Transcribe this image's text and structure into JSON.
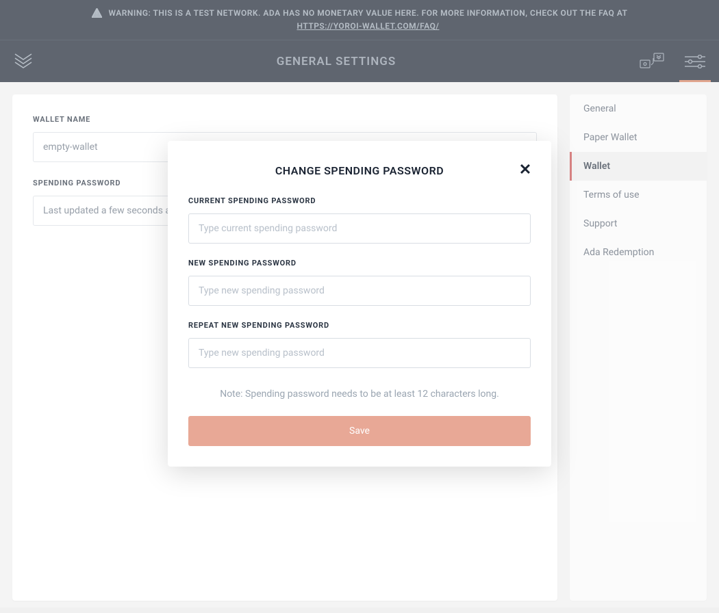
{
  "warning": {
    "text": "WARNING: THIS IS A TEST NETWORK. ADA HAS NO MONETARY VALUE HERE. FOR MORE INFORMATION, CHECK OUT THE FAQ AT",
    "link": "HTTPS://YOROI-WALLET.COM/FAQ/"
  },
  "page_title": "GENERAL SETTINGS",
  "main": {
    "wallet_name_label": "WALLET NAME",
    "wallet_name_value": "empty-wallet",
    "spending_password_label": "SPENDING PASSWORD",
    "spending_password_value": "Last updated a few seconds ago"
  },
  "nav": {
    "items": [
      {
        "label": "General",
        "active": false
      },
      {
        "label": "Paper Wallet",
        "active": false
      },
      {
        "label": "Wallet",
        "active": true
      },
      {
        "label": "Terms of use",
        "active": false
      },
      {
        "label": "Support",
        "active": false
      },
      {
        "label": "Ada Redemption",
        "active": false
      }
    ]
  },
  "modal": {
    "title": "CHANGE SPENDING PASSWORD",
    "current_label": "CURRENT SPENDING PASSWORD",
    "current_placeholder": "Type current spending password",
    "new_label": "NEW SPENDING PASSWORD",
    "new_placeholder": "Type new spending password",
    "repeat_label": "REPEAT NEW SPENDING PASSWORD",
    "repeat_placeholder": "Type new spending password",
    "note": "Note: Spending password needs to be at least 12 characters long.",
    "save_label": "Save"
  },
  "colors": {
    "banner_bg": "#1a2332",
    "accent": "#d4805e",
    "nav_active": "#c84e4e",
    "save_btn": "#e8a896"
  }
}
